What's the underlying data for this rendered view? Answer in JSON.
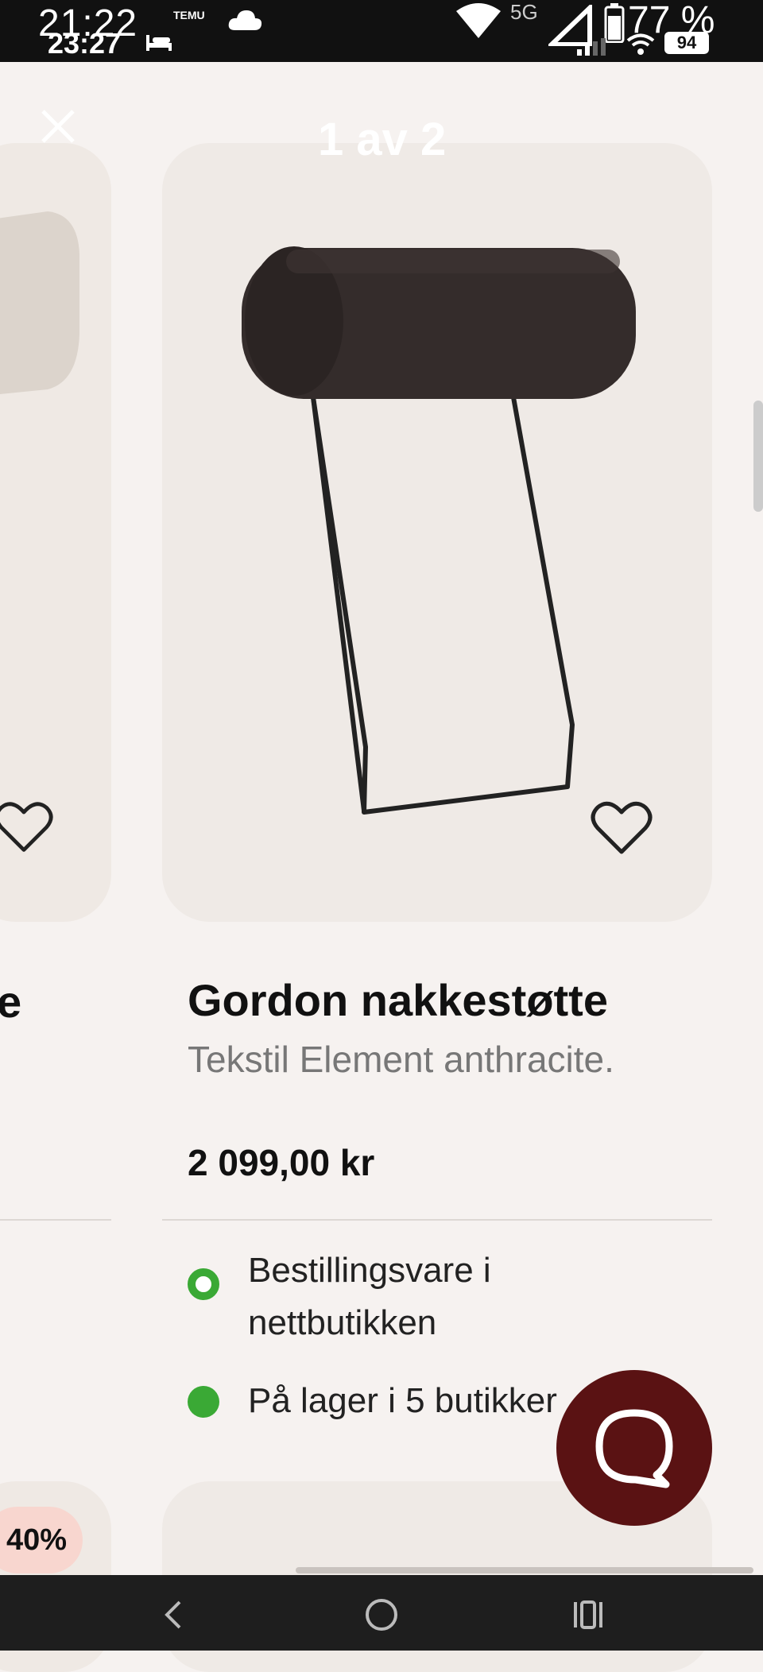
{
  "status_bar": {
    "time_primary": "21:22",
    "time_secondary": "23:27",
    "app_label": "TEMU",
    "network_type": "5G",
    "battery_percent": "77 %",
    "battery_secondary": "94"
  },
  "viewer": {
    "counter": "1 av 2"
  },
  "product": {
    "title": "Gordon nakkestøtte",
    "subtitle": "Tekstil Element anthracite.",
    "price": "2 099,00 kr",
    "availability": [
      {
        "text": "Bestillingsvare i nettbutikken",
        "style": "ring",
        "color": "#3aa935"
      },
      {
        "text": "På lager i 5 butikker",
        "style": "filled",
        "color": "#3aa935"
      }
    ]
  },
  "neighbor_cards": {
    "left_title_fragment": "e",
    "discount_badge": "40%"
  },
  "chat_button": {
    "icon": "chat-bubble-icon",
    "color": "#5a1213"
  },
  "colors": {
    "background": "#f6f2f0",
    "card_background": "#efeae6",
    "status_green": "#3aa935",
    "badge_background": "#f8d6cf"
  }
}
